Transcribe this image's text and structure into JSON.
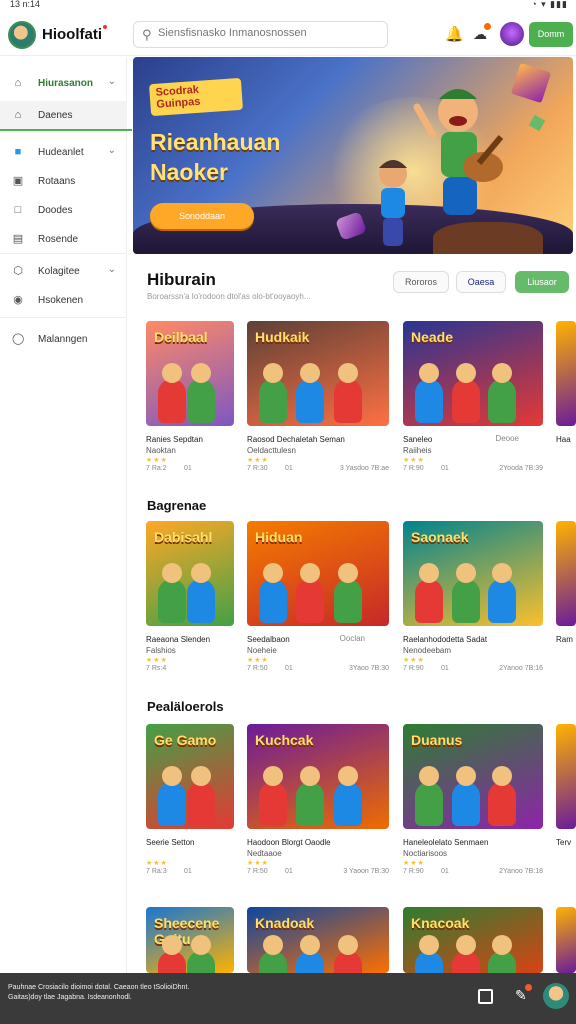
{
  "status_bar": {
    "left": "13 n:14",
    "right": "◔  ▾ ▮▮▮"
  },
  "header": {
    "app_name": "Hioolfati",
    "search_placeholder": "Siensfisnasko Inmanosnossen",
    "action_button": "Domm"
  },
  "sidebar": {
    "items": [
      {
        "label": "Hiurasanon",
        "icon": "home-outline-icon",
        "chevron": true
      },
      {
        "label": "Daenes",
        "icon": "home-icon",
        "active": true
      },
      {
        "label": "Hudeanlet",
        "icon": "folder-icon",
        "chevron": true
      },
      {
        "label": "Rotaans",
        "icon": "box-icon"
      },
      {
        "label": "Doodes",
        "icon": "book-icon"
      },
      {
        "label": "Rosende",
        "icon": "chart-icon"
      },
      {
        "label": "Kolagitee",
        "icon": "hexagon-icon",
        "chevron": true
      },
      {
        "label": "Hsokenen",
        "icon": "basket-icon"
      },
      {
        "label": "Malanngen",
        "icon": "shield-icon"
      }
    ]
  },
  "hero": {
    "tag": "Scodrak Guinpas",
    "title_line1": "Rieanhauan",
    "title_line2": "Naoker",
    "cta": "Sonoddaan"
  },
  "main_section": {
    "title": "Hiburain",
    "subtitle": "Boroarssn'a Io'rodoon dtol'as olo-bt'ooyaoyh...",
    "filters": [
      "Rororos",
      "Oaesa",
      "Liusaor"
    ]
  },
  "sections": [
    {
      "title": "",
      "cards": [
        {
          "art": "Deilbaal",
          "name": "Ranies Sepdtan",
          "sub": "Naoktan",
          "side": "",
          "rating": "7 Ra:2",
          "meta": "",
          "meta2": "01",
          "palette": [
            "#ff8a65",
            "#7e57c2"
          ]
        },
        {
          "art": "Hudkaik",
          "name": "Raosod Dechaletah Seman",
          "sub": "Oeldacttulesn",
          "side": "",
          "rating": "7 R:30",
          "meta": "3 Yasdoo  7B:ae",
          "meta2": "01",
          "palette": [
            "#5d4037",
            "#ff7043"
          ]
        },
        {
          "art": "Neade",
          "name": "Saneleo",
          "sub": "Raiiheis",
          "side": "Deooe",
          "rating": "7 R:90",
          "meta": "2Yooda  7B:39",
          "meta2": "01",
          "palette": [
            "#283593",
            "#e53935"
          ]
        }
      ]
    },
    {
      "title": "Bagrenae",
      "cards": [
        {
          "art": "Dabisahl",
          "name": "Raeaona Slenden",
          "sub": "Falshios",
          "side": "",
          "rating": "7 Rs:4",
          "meta": "",
          "meta2": "",
          "palette": [
            "#ffa726",
            "#43a047"
          ]
        },
        {
          "art": "Hiduan",
          "name": "Seedalbaon",
          "sub": "Noeheie",
          "side": "Ooclan",
          "rating": "7 R:50",
          "meta": "3Yaoo  7B:30",
          "meta2": "01",
          "palette": [
            "#f57c00",
            "#c62828"
          ]
        },
        {
          "art": "Saonaek",
          "name": "Raelanhododetta Sadat",
          "sub": "Nenodeebam",
          "side": "",
          "rating": "7 R:90",
          "meta": "2Yanoo  7B:16",
          "meta2": "01",
          "palette": [
            "#00838f",
            "#fbc02d"
          ]
        }
      ]
    },
    {
      "title": "Pealäloerols",
      "cards": [
        {
          "art": "Ge Gamo",
          "name": "Seerie Setton",
          "sub": "",
          "side": "",
          "rating": "7 Ra:3",
          "meta": "",
          "meta2": "01",
          "palette": [
            "#43a047",
            "#e53935"
          ]
        },
        {
          "art": "Kuchcak",
          "name": "Haodoon Blorgt Oaodle",
          "sub": "Nedtaaoe",
          "side": "",
          "rating": "7 R:50",
          "meta": "3 Yaoon  7B:30",
          "meta2": "01",
          "palette": [
            "#6a1b9a",
            "#ef6c00"
          ]
        },
        {
          "art": "Duanus",
          "name": "Haneleolelato Senmaen",
          "sub": "Noctiarisoos",
          "side": "",
          "rating": "7 R:90",
          "meta": "2Yanoo  7B:18",
          "meta2": "01",
          "palette": [
            "#2e7d32",
            "#8e24aa"
          ]
        }
      ]
    },
    {
      "title": "",
      "cards": [
        {
          "art": "Sheecene Guitu",
          "name": "",
          "sub": "",
          "side": "",
          "rating": "",
          "meta": "",
          "meta2": "",
          "palette": [
            "#1976d2",
            "#ffb300"
          ]
        },
        {
          "art": "Knadoak",
          "name": "",
          "sub": "",
          "side": "",
          "rating": "",
          "meta": "",
          "meta2": "",
          "palette": [
            "#0d47a1",
            "#ff6f00"
          ]
        },
        {
          "art": "Knacoak",
          "name": "",
          "sub": "",
          "side": "",
          "rating": "",
          "meta": "",
          "meta2": "",
          "palette": [
            "#2e7d32",
            "#d84315"
          ]
        }
      ]
    }
  ],
  "peek_titles": [
    "Haa",
    "Ram",
    "Terv",
    ""
  ],
  "bottom_bar": {
    "text": "Pauhnae Crosiacilo dioimoi dotal. Caeaon tleo tSolioiDhnt. Gaitas)doy tlae Jagabna. Isdeanonhodl."
  }
}
